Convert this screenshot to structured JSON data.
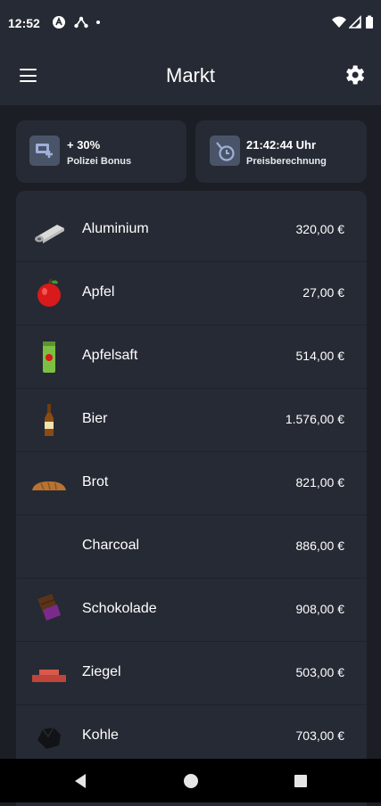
{
  "status_bar": {
    "time": "12:52"
  },
  "app_bar": {
    "title": "Markt"
  },
  "info_cards": [
    {
      "value": "+ 30%",
      "label": "Polizei Bonus",
      "icon": "police-bonus-icon"
    },
    {
      "value": "21:42:44 Uhr",
      "label": "Preisberechnung",
      "icon": "timer-icon"
    }
  ],
  "market": {
    "items": [
      {
        "name": "Aluminium",
        "price": "320,00 €",
        "icon": "aluminium-roll-icon"
      },
      {
        "name": "Apfel",
        "price": "27,00 €",
        "icon": "apple-icon"
      },
      {
        "name": "Apfelsaft",
        "price": "514,00 €",
        "icon": "apple-juice-icon"
      },
      {
        "name": "Bier",
        "price": "1.576,00 €",
        "icon": "beer-bottle-icon"
      },
      {
        "name": "Brot",
        "price": "821,00 €",
        "icon": "bread-icon"
      },
      {
        "name": "Charcoal",
        "price": "886,00 €",
        "icon": ""
      },
      {
        "name": "Schokolade",
        "price": "908,00 €",
        "icon": "chocolate-icon"
      },
      {
        "name": "Ziegel",
        "price": "503,00 €",
        "icon": "brick-icon"
      },
      {
        "name": "Kohle",
        "price": "703,00 €",
        "icon": "coal-icon"
      }
    ]
  },
  "colors": {
    "background": "#1b1e24",
    "surface": "#262a34",
    "icon_tile": "#4a5468",
    "text": "#ffffff"
  }
}
